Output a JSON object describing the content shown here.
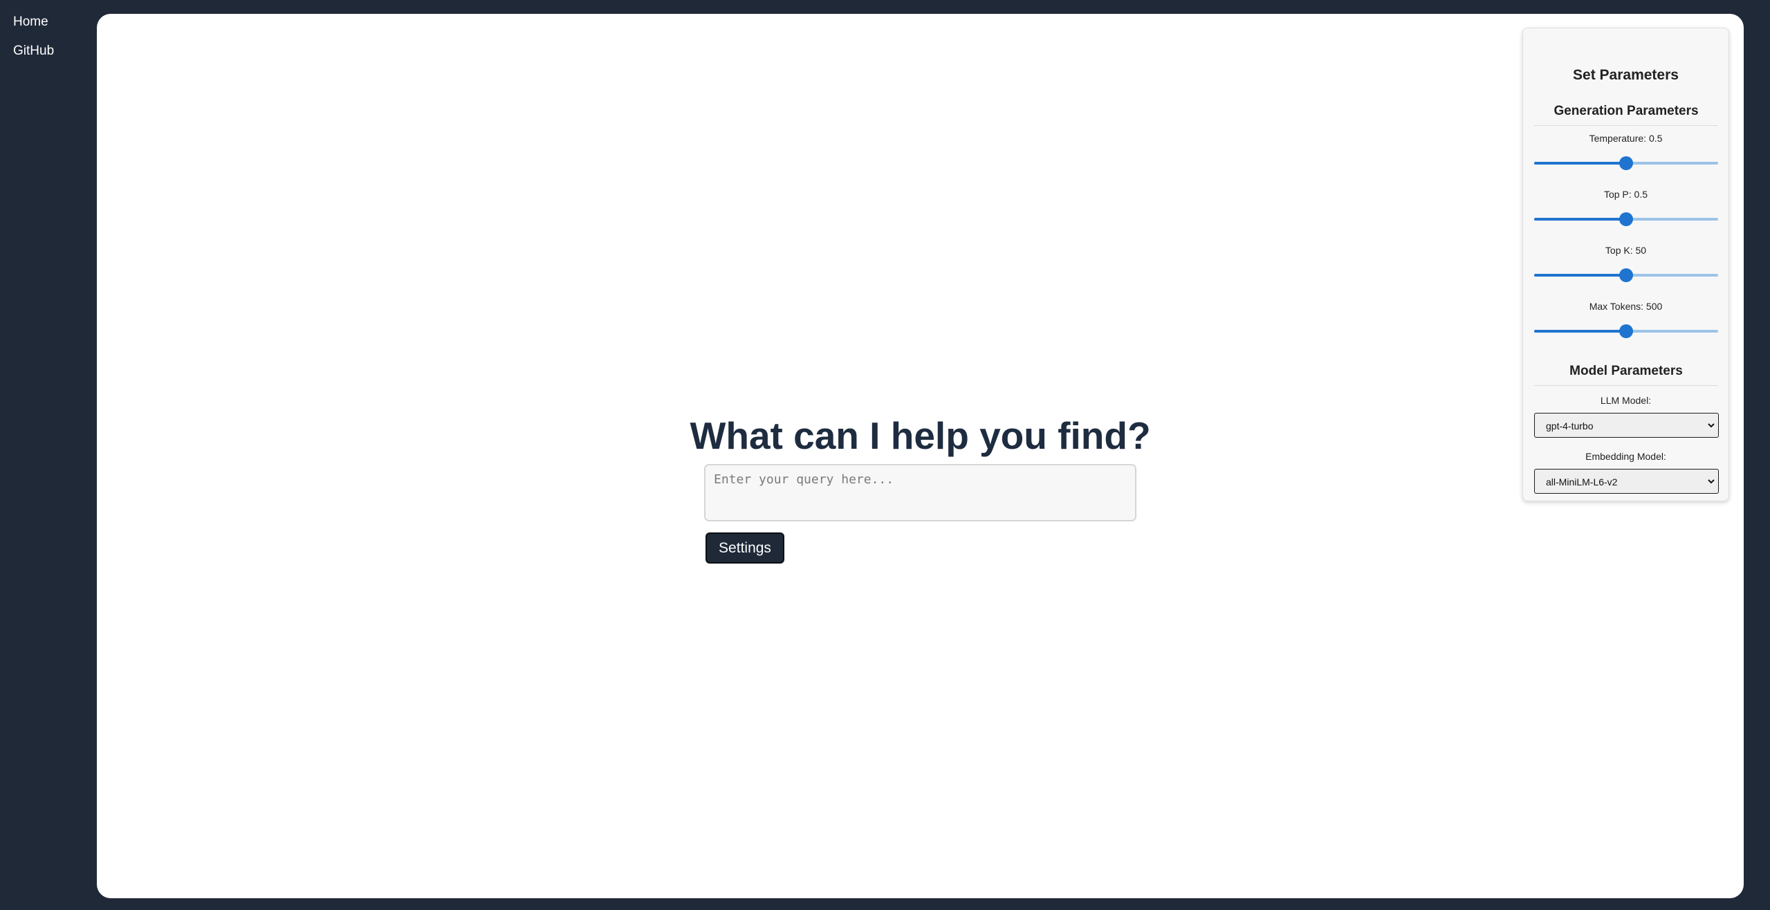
{
  "nav": {
    "home": "Home",
    "github": "GitHub"
  },
  "main": {
    "heading": "What can I help you find?",
    "query_placeholder": "Enter your query here...",
    "settings_label": "Settings"
  },
  "params": {
    "title": "Set Parameters",
    "generation_title": "Generation Parameters",
    "sliders": [
      {
        "label": "Temperature: 0.5",
        "fraction": 0.5
      },
      {
        "label": "Top P: 0.5",
        "fraction": 0.5
      },
      {
        "label": "Top K: 50",
        "fraction": 0.5
      },
      {
        "label": "Max Tokens: 500",
        "fraction": 0.5
      }
    ],
    "model_title": "Model Parameters",
    "llm_label": "LLM Model:",
    "llm_value": "gpt-4-turbo",
    "embedding_label": "Embedding Model:",
    "embedding_value": "all-MiniLM-L6-v2"
  },
  "colors": {
    "background": "#202938",
    "heading": "#1e2c40",
    "slider_active": "#1f74d0",
    "slider_track": "#9cc3e8"
  }
}
